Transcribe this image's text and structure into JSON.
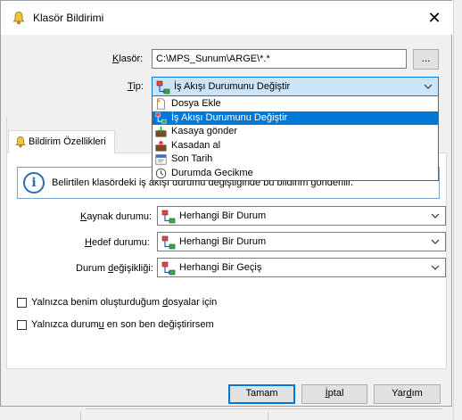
{
  "dialog": {
    "title": "Klasör Bildirimi",
    "close_glyph": "✕"
  },
  "folder": {
    "label": "Klasör:",
    "value": "C:\\MPS_Sunum\\ARGE\\*.*",
    "browse_label": "..."
  },
  "type": {
    "label": "Tip:",
    "selected": "İş Akışı Durumunu Değiştir",
    "options": [
      {
        "label": "Dosya Ekle",
        "icon": "add-file-icon"
      },
      {
        "label": "İş Akışı Durumunu Değiştir",
        "icon": "workflow-icon"
      },
      {
        "label": "Kasaya gönder",
        "icon": "check-in-icon"
      },
      {
        "label": "Kasadan al",
        "icon": "check-out-icon"
      },
      {
        "label": "Son Tarih",
        "icon": "due-date-icon"
      },
      {
        "label": "Durumda Gecikme",
        "icon": "delay-icon"
      }
    ],
    "selected_index": 1
  },
  "tab": {
    "label": "Bildirim Özellikleri",
    "icon": "bell-icon"
  },
  "info": {
    "text": "Belirtilen klasördeki iş akışı durumu değiştiğinde bu bildirim gönderilir."
  },
  "fields": {
    "source": {
      "label": "Kaynak durumu:",
      "value": "Herhangi Bir Durum"
    },
    "target": {
      "label": "Hedef durumu:",
      "value": "Herhangi Bir Durum"
    },
    "transition": {
      "label": "Durum değişikliği:",
      "value": "Herhangi Bir Geçiş"
    }
  },
  "checkboxes": {
    "only_mine": {
      "label": "Yalnızca benim oluşturduğum dosyalar için",
      "checked": false
    },
    "last_changed": {
      "label": "Yalnızca durumu en son ben değiştirirsem",
      "checked": false
    }
  },
  "buttons": {
    "ok": "Tamam",
    "cancel": "İptal",
    "help": "Yardım"
  },
  "colors": {
    "accent": "#0078d7",
    "selection": "#0078d7",
    "dialog_bg": "#f0f0f0"
  }
}
